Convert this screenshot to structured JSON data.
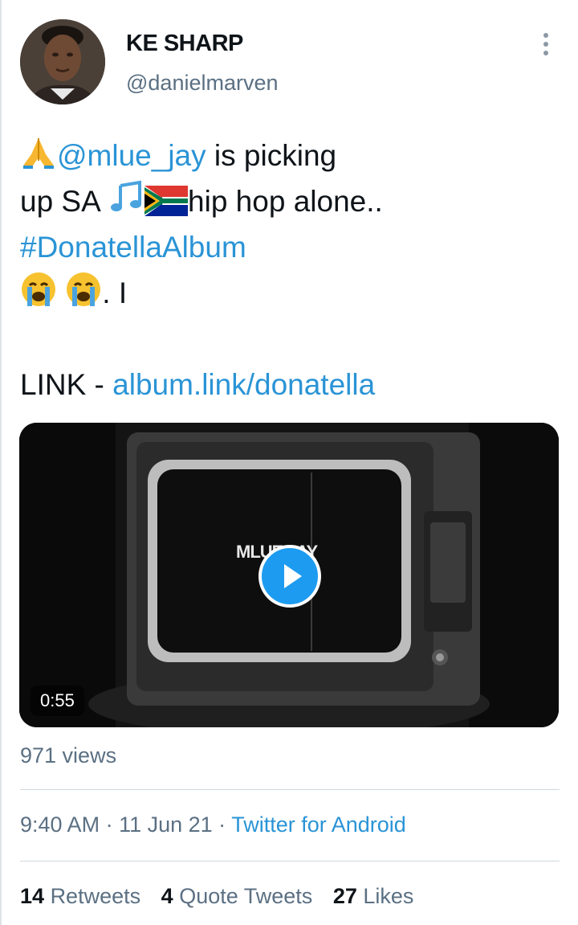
{
  "author": {
    "name": "KE SHARP",
    "handle": "@danielmarven"
  },
  "tweet": {
    "mention": "@mlue_jay",
    "line1_rest": " is picking",
    "line2_start": "up SA ",
    "line2_rest": "hip hop alone..",
    "hashtag": "#DonatellaAlbum",
    "line4_rest": ". I",
    "link_prefix": "LINK - ",
    "link": "album.link/donatella",
    "emoji": [
      "folded-hands",
      "musical-notes",
      "south-africa-flag",
      "crying-face",
      "crying-face"
    ]
  },
  "media": {
    "overlay_text": "MLUE JAY",
    "duration": "0:55"
  },
  "views": "971 views",
  "meta": {
    "time": "9:40 AM",
    "separator": " · ",
    "date": "11 Jun 21",
    "source": "Twitter for Android"
  },
  "stats": {
    "retweets_count": "14",
    "retweets_label": "Retweets",
    "quote_count": "4",
    "quote_label": "Quote Tweets",
    "likes_count": "27",
    "likes_label": "Likes"
  },
  "colors": {
    "link": "#2a94d6",
    "secondary_text": "#5b7083",
    "play_button": "#1d9bf0"
  }
}
